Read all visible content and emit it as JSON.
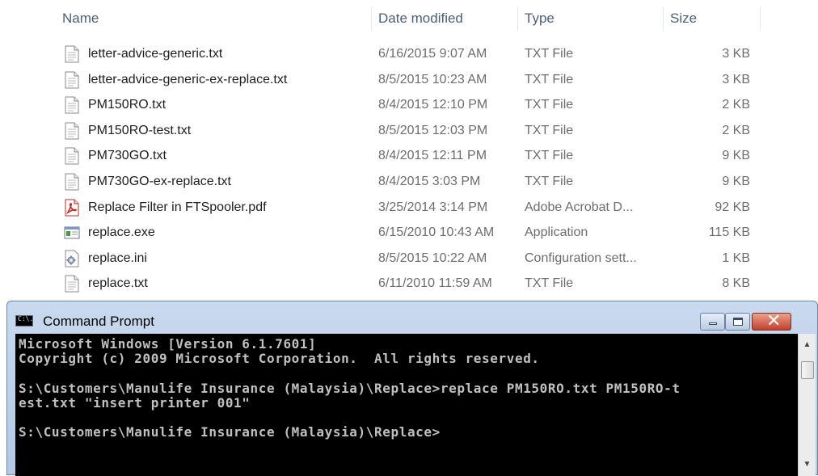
{
  "explorer": {
    "columns": {
      "name": "Name",
      "date": "Date modified",
      "type": "Type",
      "size": "Size"
    },
    "files": [
      {
        "name": "letter-advice-generic.txt",
        "date": "6/16/2015 9:07 AM",
        "type": "TXT File",
        "size": "3 KB",
        "icon": "text-file-icon"
      },
      {
        "name": "letter-advice-generic-ex-replace.txt",
        "date": "8/5/2015 10:23 AM",
        "type": "TXT File",
        "size": "3 KB",
        "icon": "text-file-icon"
      },
      {
        "name": "PM150RO.txt",
        "date": "8/4/2015 12:10 PM",
        "type": "TXT File",
        "size": "2 KB",
        "icon": "text-file-icon"
      },
      {
        "name": "PM150RO-test.txt",
        "date": "8/5/2015 12:03 PM",
        "type": "TXT File",
        "size": "2 KB",
        "icon": "text-file-icon"
      },
      {
        "name": "PM730GO.txt",
        "date": "8/4/2015 12:11 PM",
        "type": "TXT File",
        "size": "9 KB",
        "icon": "text-file-icon"
      },
      {
        "name": "PM730GO-ex-replace.txt",
        "date": "8/4/2015 3:03 PM",
        "type": "TXT File",
        "size": "9 KB",
        "icon": "text-file-icon"
      },
      {
        "name": "Replace Filter in FTSpooler.pdf",
        "date": "3/25/2014 3:14 PM",
        "type": "Adobe Acrobat D...",
        "size": "92 KB",
        "icon": "pdf-file-icon"
      },
      {
        "name": "replace.exe",
        "date": "6/15/2010 10:43 AM",
        "type": "Application",
        "size": "115 KB",
        "icon": "application-icon"
      },
      {
        "name": "replace.ini",
        "date": "8/5/2015 10:22 AM",
        "type": "Configuration sett...",
        "size": "1 KB",
        "icon": "settings-file-icon"
      },
      {
        "name": "replace.txt",
        "date": "6/11/2010 11:59 AM",
        "type": "TXT File",
        "size": "8 KB",
        "icon": "text-file-icon"
      }
    ]
  },
  "cmd": {
    "title": "Command Prompt",
    "icon_label": "C:\\.",
    "lines": [
      "Microsoft Windows [Version 6.1.7601]",
      "Copyright (c) 2009 Microsoft Corporation.  All rights reserved.",
      "",
      "S:\\Customers\\Manulife Insurance (Malaysia)\\Replace>replace PM150RO.txt PM150RO-t",
      "est.txt \"insert printer 001\"",
      "",
      "S:\\Customers\\Manulife Insurance (Malaysia)\\Replace>"
    ],
    "buttons": {
      "close_glyph": "✕"
    },
    "scroll": {
      "up": "▲",
      "down": "▼"
    }
  },
  "colors": {
    "console_bg": "#000000",
    "console_text": "#c0c0c0",
    "header_text": "#4c607a"
  }
}
